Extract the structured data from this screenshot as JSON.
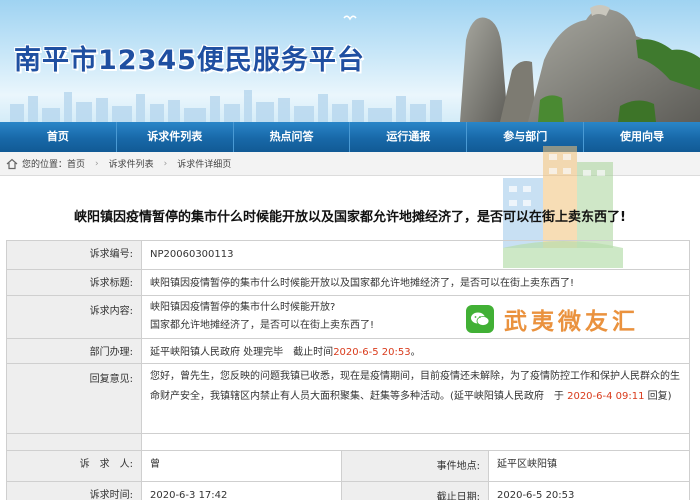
{
  "banner": {
    "title": "南平市12345便民服务平台"
  },
  "nav": {
    "items": [
      "首页",
      "诉求件列表",
      "热点问答",
      "运行通报",
      "参与部门",
      "使用向导"
    ]
  },
  "breadcrumb": {
    "prefix": "您的位置：",
    "items": [
      "首页",
      "诉求件列表",
      "诉求件详细页"
    ]
  },
  "watermark": {
    "text": "武夷微友汇"
  },
  "detail": {
    "heading": "峡阳镇因疫情暂停的集市什么时候能开放以及国家都允许地摊经济了，是否可以在街上卖东西了!",
    "labels": {
      "code": "诉求编号:",
      "title": "诉求标题:",
      "content": "诉求内容:",
      "dept": "部门办理:",
      "reply": "回复意见:",
      "person": "诉　求　人:",
      "time": "诉求时间:",
      "location": "事件地点:",
      "deadline": "截止日期:"
    },
    "code": "NP20060300113",
    "title": "峡阳镇因疫情暂停的集市什么时候能开放以及国家都允许地摊经济了，是否可以在街上卖东西了!",
    "content_line1": "峡阳镇因疫情暂停的集市什么时候能开放?",
    "content_line2": "国家都允许地摊经济了，是否可以在街上卖东西了!",
    "dept_text": "延平峡阳镇人民政府 处理完毕　截止时间",
    "dept_time": "2020-6-5 20:53",
    "dept_suffix": "。",
    "reply_text": "您好，曾先生，您反映的问题我镇已收悉，现在是疫情期间，目前疫情还未解除，为了疫情防控工作和保护人民群众的生命财产安全，我镇辖区内禁止有人员大面积聚集、赶集等多种活动。(延平峡阳镇人民政府　于",
    "reply_time": "2020-6-4 09:11",
    "reply_suffix": "回复)",
    "person": "曾",
    "time": "2020-6-3 17:42",
    "location": "延平区峡阳镇",
    "deadline": "2020-6-5 20:53"
  },
  "colors": {
    "nav": "#1868a8",
    "title": "#1f4fa1",
    "highlight": "#d93b1c",
    "watermark": "#e8872a"
  }
}
